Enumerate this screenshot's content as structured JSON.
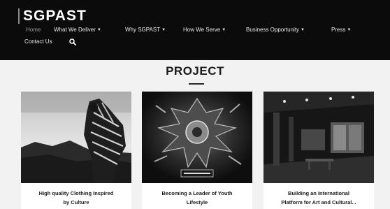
{
  "site": {
    "logo": "SGPAST"
  },
  "nav": {
    "items": [
      {
        "label": "Home",
        "dropdown": false,
        "active": true
      },
      {
        "label": "What We Deliver",
        "dropdown": true
      },
      {
        "label": "Why SGPAST",
        "dropdown": true
      },
      {
        "label": "How We Serve",
        "dropdown": true
      },
      {
        "label": "Business Opportunity",
        "dropdown": true
      },
      {
        "label": "Press",
        "dropdown": true
      }
    ],
    "contact": "Contact Us",
    "search_icon": "search-icon",
    "dropdown_icon": "chevron-down-icon"
  },
  "section": {
    "title": "PROJECT"
  },
  "cards": [
    {
      "title_line1": "High quality Clothing Inspired",
      "title_line2": "by Culture"
    },
    {
      "title_line1": "Becoming a Leader of Youth",
      "title_line2": "Lifestyle"
    },
    {
      "title_line1": "Building an International",
      "title_line2": "Platform for Art and Cultural..."
    }
  ],
  "colors": {
    "header_bg": "#0b0b0b",
    "page_bg": "#f2f2f2",
    "nav_active": "#9a9a9a"
  }
}
